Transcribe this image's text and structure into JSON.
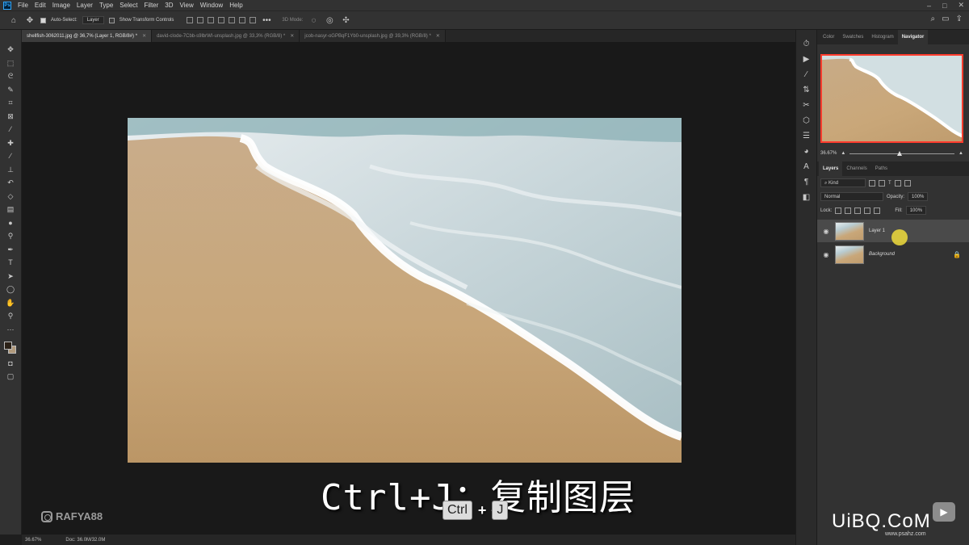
{
  "menubar": {
    "logo": "Ps",
    "items": [
      "File",
      "Edit",
      "Image",
      "Layer",
      "Type",
      "Select",
      "Filter",
      "3D",
      "View",
      "Window",
      "Help"
    ]
  },
  "options": {
    "auto_select_label": "Auto-Select:",
    "auto_select_value": "Layer",
    "show_transform_label": "Show Transform Controls",
    "mode_3d_label": "3D Mode:"
  },
  "doc_tabs": [
    {
      "label": "shellfish-3062011.jpg @ 36,7% (Layer 1, RGB/8#) *"
    },
    {
      "label": "david-clode-7Cbb-s9lbrWI-unsplash.jpg @ 33,3% (RGB/8) *"
    },
    {
      "label": "jcob-nasyr-oGPBqF1Yb0-unsplash.jpg @ 39,3% (RGB/8) *"
    }
  ],
  "canvas": {
    "caption": "Ctrl+J：复制图层",
    "key1": "Ctrl",
    "plus": "+",
    "key2": "J",
    "watermark_left": "RAFYA88"
  },
  "statusbar": {
    "zoom": "36.67%",
    "doc": "Doc: 36.0M/32.0M"
  },
  "navigator": {
    "tabs": [
      "Color",
      "Swatches",
      "Histogram",
      "Navigator"
    ],
    "active_tab": "Navigator",
    "zoom": "36.67%"
  },
  "layers": {
    "tabs": [
      "Layers",
      "Channels",
      "Paths"
    ],
    "filter_kind": "Kind",
    "blend_mode": "Normal",
    "opacity_label": "Opacity:",
    "opacity_value": "100%",
    "lock_label": "Lock:",
    "fill_label": "Fill:",
    "fill_value": "100%",
    "items": [
      {
        "name": "Layer 1",
        "selected": true
      },
      {
        "name": "Background",
        "selected": false
      }
    ]
  },
  "watermark_right": {
    "text": "UiBQ.CoM",
    "sub": "www.psahz.com"
  },
  "icons": {
    "move": "move-icon",
    "play": "play-icon"
  }
}
